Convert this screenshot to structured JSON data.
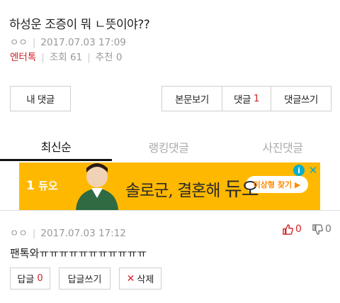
{
  "post": {
    "title": "하성운 조증이 뭐 ㄴ뜻이야??",
    "author": "ㅇㅇ",
    "datetime": "2017.07.03 17:09",
    "category": "엔터톡",
    "views": "조회 61",
    "recommend": "추천 0"
  },
  "actions": {
    "my_comments": "내 댓글",
    "view_body": "본문보기",
    "comments_label": "댓글",
    "comments_count": "1",
    "write_comment": "댓글쓰기"
  },
  "tabs": [
    "최신순",
    "랭킹댓글",
    "사진댓글"
  ],
  "ad": {
    "brand": "듀오",
    "slogan_a": "솔로군, 결혼해",
    "slogan_b": "듀오",
    "cta": "이상형 찾기 ▶",
    "info": "i",
    "close": "✕"
  },
  "comment": {
    "author": "ㅇㅇ",
    "datetime": "2017.07.03 17:12",
    "text": "팬톡와ㅠㅠㅠㅠㅠㅠㅠㅠㅠㅠㅠ",
    "up_count": "0",
    "down_count": "0",
    "reply_label": "답글",
    "reply_count": "0",
    "write_reply": "답글쓰기",
    "delete": "삭제"
  },
  "colors": {
    "accent": "#d1242b",
    "ad_bg": "#ffb800"
  }
}
